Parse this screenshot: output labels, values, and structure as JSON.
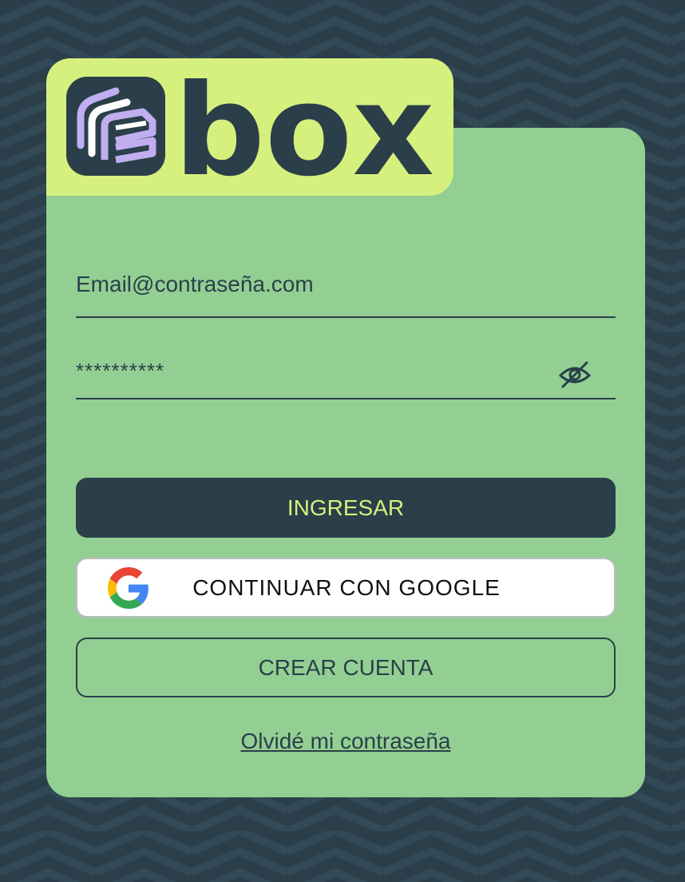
{
  "brand": {
    "logo_text": "box",
    "colors": {
      "background": "#2a3f49",
      "card": "#93cf93",
      "logo_tab": "#d6f07e",
      "primary_button": "#2a3f49",
      "primary_button_text": "#d6f07e",
      "logo_mark_accent": "#c0aef0"
    }
  },
  "form": {
    "email": {
      "value": "Email@contraseña.com",
      "placeholder": "Email@contraseña.com"
    },
    "password": {
      "value": "**********",
      "toggle_icon": "eye-slash-icon"
    }
  },
  "buttons": {
    "login_label": "INGRESAR",
    "google_label": "CONTINUAR CON GOOGLE",
    "create_label": "CREAR CUENTA"
  },
  "links": {
    "forgot_label": "Olvidé mi contraseña"
  }
}
